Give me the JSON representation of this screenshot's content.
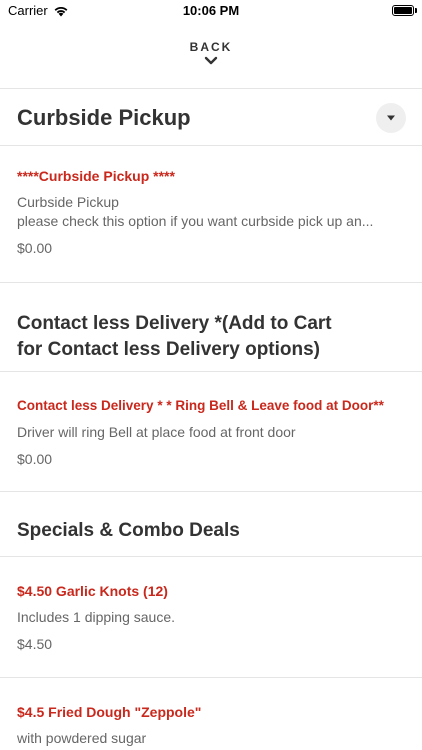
{
  "status_bar": {
    "carrier": "Carrier",
    "time": "10:06 PM"
  },
  "header": {
    "back_label": "BACK"
  },
  "sections": [
    {
      "title": "Curbside Pickup",
      "items": [
        {
          "name": "****Curbside Pickup ****",
          "description": "Curbside Pickup",
          "description2": "please check this option if you want curbside pick up an...",
          "price": "$0.00"
        }
      ]
    },
    {
      "title_line1": "Contact less Delivery *(Add to Cart",
      "title_line2": "for Contact less Delivery options)",
      "items": [
        {
          "name": "Contact less Delivery * * Ring Bell & Leave food at Door**",
          "description": "Driver will ring Bell at place food at front door",
          "price": "$0.00"
        }
      ]
    },
    {
      "title": "Specials & Combo Deals",
      "items": [
        {
          "name": "$4.50 Garlic Knots (12)",
          "description": "Includes 1 dipping sauce.",
          "price": "$4.50"
        },
        {
          "name": "$4.5 Fried Dough \"Zeppole\"",
          "description": "with powdered sugar"
        }
      ]
    }
  ],
  "colors": {
    "accent": "#c9281c",
    "text": "#333333",
    "muted": "#666666",
    "divider": "#e5e5e5"
  }
}
